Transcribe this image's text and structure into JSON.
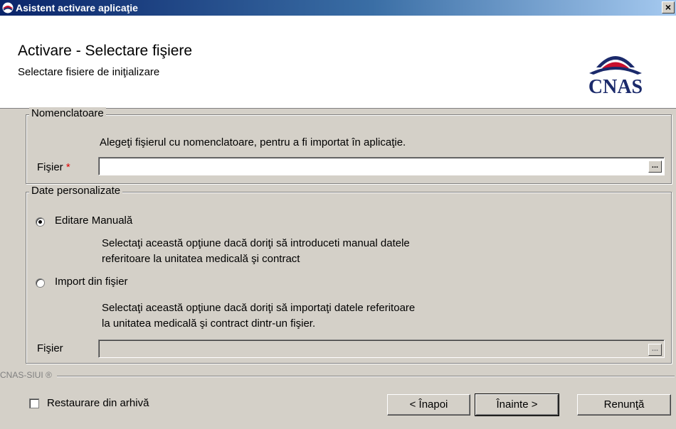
{
  "window": {
    "title": "Asistent activare aplicaţie",
    "close_glyph": "×",
    "app_icon": "cnas-icon"
  },
  "header": {
    "title": "Activare - Selectare fişiere",
    "subtitle": "Selectare fisiere de iniţializare",
    "logo_text": "CNAS"
  },
  "nomenclatoare": {
    "legend": "Nomenclatoare",
    "description": "Alegeţi fişierul cu nomenclatoare, pentru a fi importat în aplicaţie.",
    "file_label": "Fişier",
    "required_mark": "*",
    "file_value": "",
    "browse_label": "..."
  },
  "date_personalizate": {
    "legend": "Date personalizate",
    "option_manual": {
      "label": "Editare Manuală",
      "selected": true,
      "description_line1": "Selectaţi această opţiune dacă doriţi să introduceti manual datele",
      "description_line2": "referitoare la unitatea medicală şi contract"
    },
    "option_import": {
      "label": "Import din fişier",
      "selected": false,
      "description_line1": "Selectaţi această opţiune dacă doriţi să importaţi datele referitoare",
      "description_line2": "la unitatea medicală şi contract dintr-un fişier."
    },
    "file_label": "Fişier",
    "file_value": "",
    "browse_label": "..."
  },
  "footer": {
    "brand": "CNAS-SIUI ®",
    "restore_label": "Restaurare din arhivă",
    "restore_checked": false,
    "back_label": "< Înapoi",
    "next_label": "Înainte >",
    "cancel_label": "Renunţă"
  },
  "colors": {
    "accent": "#0a246a",
    "logo_red": "#c8102e",
    "logo_navy": "#1b2a6b"
  }
}
